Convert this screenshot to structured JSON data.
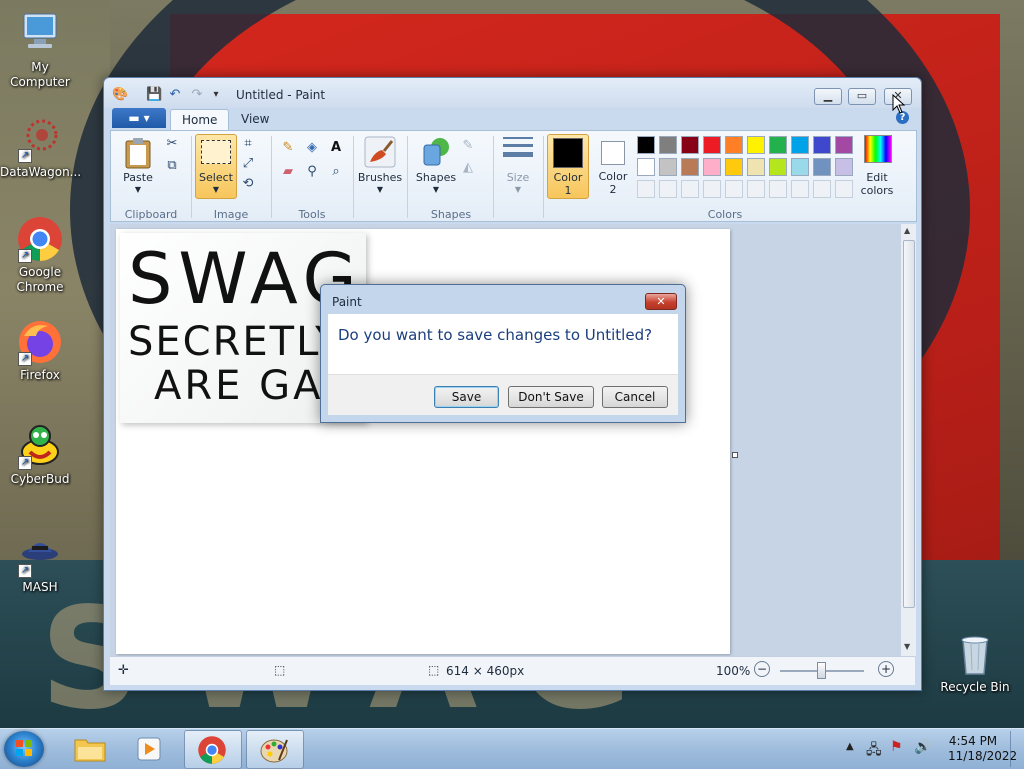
{
  "desktop": {
    "icons": [
      {
        "label": "My Computer"
      },
      {
        "label": "DataWagon..."
      },
      {
        "label": "Google\nChrome"
      },
      {
        "label": "Firefox"
      },
      {
        "label": "CyberBud"
      },
      {
        "label": "MASH"
      },
      {
        "label": "Recycle Bin"
      }
    ],
    "wallpaper_text": "SWAG"
  },
  "window": {
    "title": "Untitled - Paint",
    "file_tab": "▾",
    "tabs": [
      "Home",
      "View"
    ],
    "ribbon": {
      "paste": "Paste",
      "select": "Select",
      "brushes": "Brushes",
      "shapes": "Shapes",
      "size": "Size",
      "color1": "Color\n1",
      "color2": "Color\n2",
      "edit_colors": "Edit\ncolors",
      "groups": [
        "Clipboard",
        "Image",
        "Tools",
        "Shapes",
        "Colors"
      ]
    },
    "palette": [
      "#000000",
      "#7f7f7f",
      "#880015",
      "#ed1c24",
      "#ff7f27",
      "#fff200",
      "#22b14c",
      "#00a2e8",
      "#3f48cc",
      "#a349a4",
      "#ffffff",
      "#c3c3c3",
      "#b97a57",
      "#ffaec9",
      "#ffc90e",
      "#efe4b0",
      "#b5e61d",
      "#99d9ea",
      "#7092be",
      "#c8bfe7"
    ],
    "canvas_image": {
      "line1": "SWAG",
      "line2": "SECRETLY W",
      "line3": "ARE GAY"
    },
    "status": {
      "dimensions": "614 × 460px",
      "zoom": "100%"
    }
  },
  "dialog": {
    "title": "Paint",
    "message": "Do you want to save changes to Untitled?",
    "buttons": {
      "save": "Save",
      "dont_save": "Don't Save",
      "cancel": "Cancel"
    }
  },
  "taskbar": {
    "time": "4:54 PM",
    "date": "11/18/2022"
  }
}
